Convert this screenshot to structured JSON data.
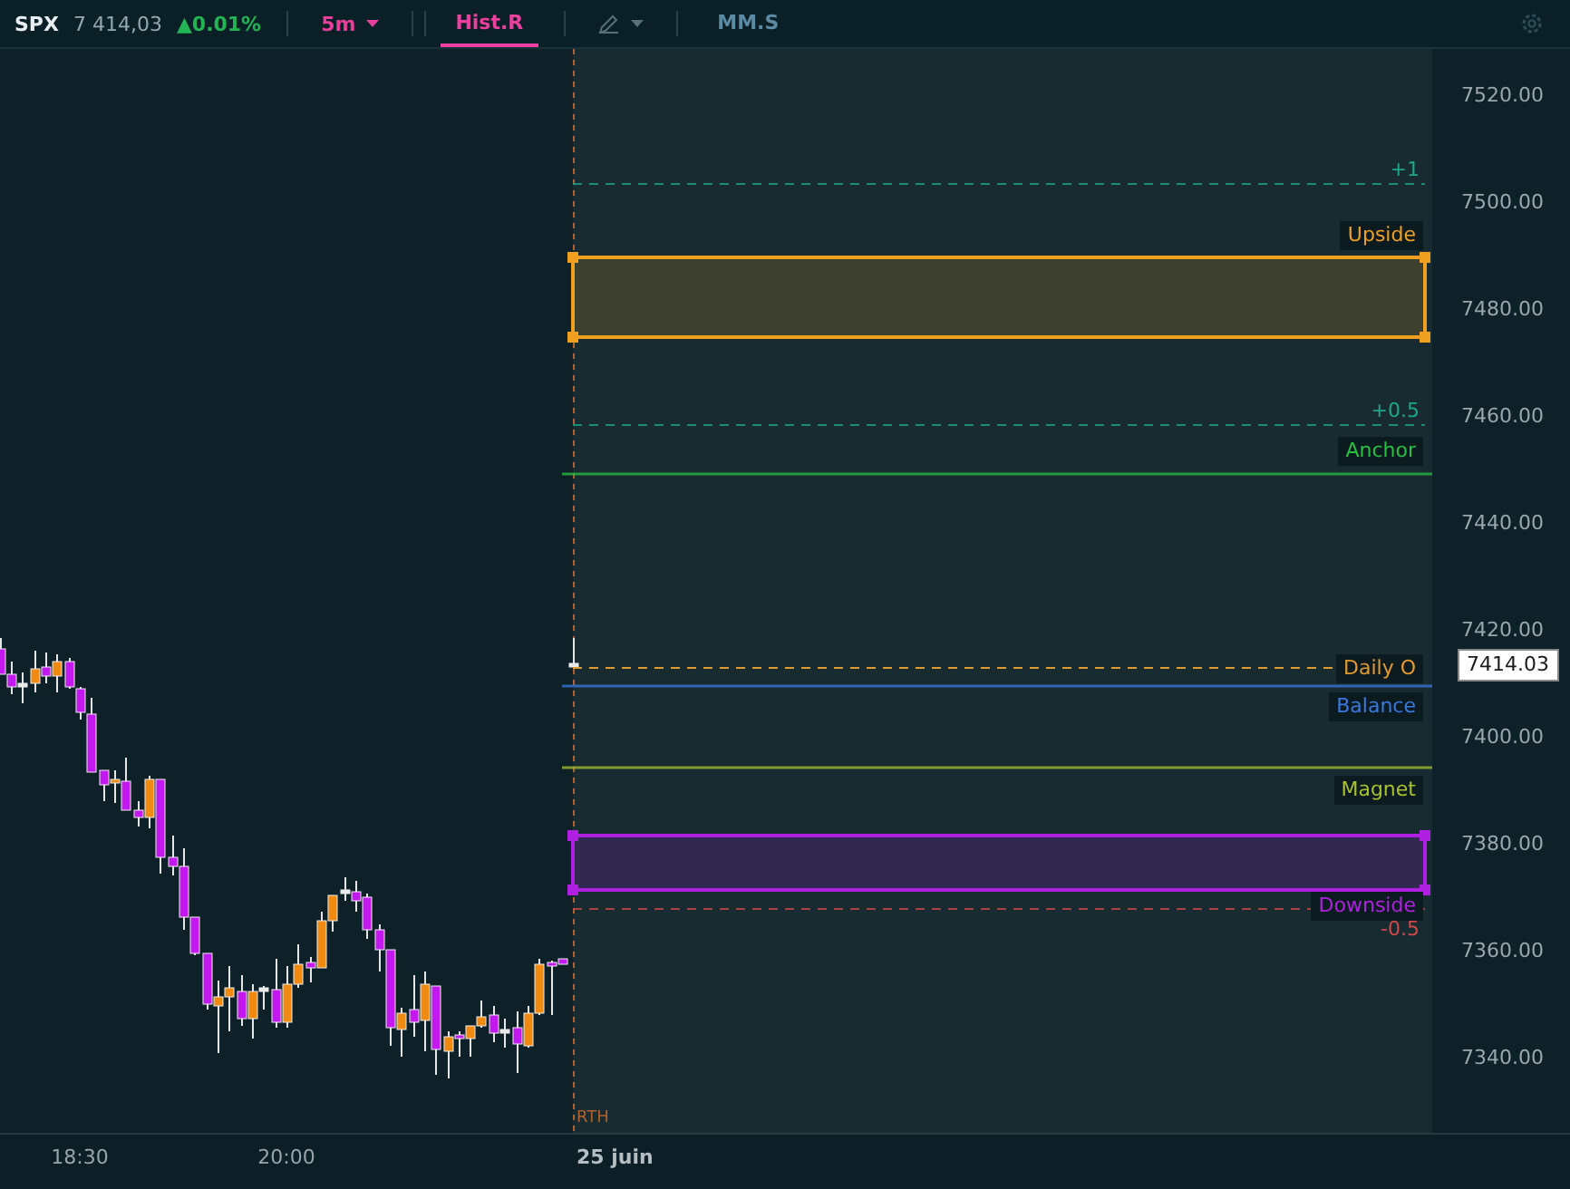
{
  "toolbar": {
    "symbol": "SPX",
    "price": "7 414,03",
    "change": "▲0.01%",
    "interval": "5m",
    "tabs": [
      {
        "label": "Hist.R",
        "selected": true
      },
      {
        "label": "MM.S",
        "selected": false
      }
    ]
  },
  "chart": {
    "session_label": "RTH",
    "levels": [
      {
        "kind": "dashed",
        "label": "+1",
        "color": "#1fa58a"
      },
      {
        "kind": "zone",
        "label": "Upside",
        "color": "#f0a020"
      },
      {
        "kind": "dashed",
        "label": "+0.5",
        "color": "#1fa58a"
      },
      {
        "kind": "line",
        "label": "Anchor",
        "color": "#28c040"
      },
      {
        "kind": "open",
        "label": "Daily O",
        "color": "#e09a30"
      },
      {
        "kind": "line",
        "label": "Balance",
        "color": "#3a78e0"
      },
      {
        "kind": "line",
        "label": "Magnet",
        "color": "#a8c030"
      },
      {
        "kind": "zone",
        "label": "Downside",
        "color": "#b020e0"
      },
      {
        "kind": "dashed",
        "label": "-0.5",
        "color": "#d04848"
      }
    ]
  },
  "price_axis": {
    "ticks": [
      "7520.00",
      "7500.00",
      "7480.00",
      "7460.00",
      "7440.00",
      "7420.00",
      "7400.00",
      "7380.00",
      "7360.00",
      "7340.00"
    ],
    "last_price": "7414.03"
  },
  "time_axis": {
    "labels": [
      {
        "kind": "time",
        "text": "18:30"
      },
      {
        "kind": "time",
        "text": "20:00"
      },
      {
        "kind": "date",
        "text": "25 juin"
      }
    ]
  }
}
